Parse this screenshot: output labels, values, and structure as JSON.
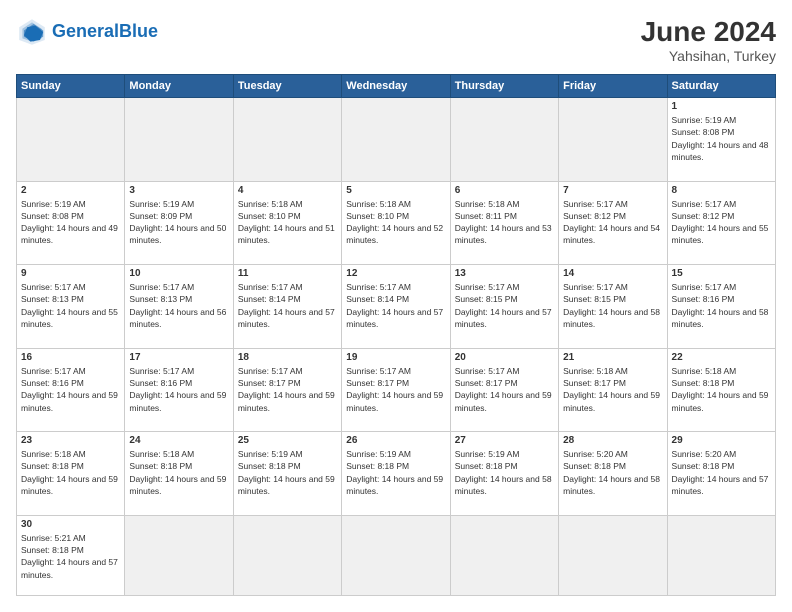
{
  "header": {
    "logo_general": "General",
    "logo_blue": "Blue",
    "month": "June 2024",
    "location": "Yahsihan, Turkey"
  },
  "weekdays": [
    "Sunday",
    "Monday",
    "Tuesday",
    "Wednesday",
    "Thursday",
    "Friday",
    "Saturday"
  ],
  "days": [
    {
      "num": "",
      "empty": true
    },
    {
      "num": "",
      "empty": true
    },
    {
      "num": "",
      "empty": true
    },
    {
      "num": "",
      "empty": true
    },
    {
      "num": "",
      "empty": true
    },
    {
      "num": "",
      "empty": true
    },
    {
      "num": "1",
      "sunrise": "5:19 AM",
      "sunset": "8:08 PM",
      "daylight": "14 hours and 48 minutes."
    },
    {
      "num": "2",
      "sunrise": "5:19 AM",
      "sunset": "8:08 PM",
      "daylight": "14 hours and 49 minutes."
    },
    {
      "num": "3",
      "sunrise": "5:19 AM",
      "sunset": "8:09 PM",
      "daylight": "14 hours and 50 minutes."
    },
    {
      "num": "4",
      "sunrise": "5:18 AM",
      "sunset": "8:10 PM",
      "daylight": "14 hours and 51 minutes."
    },
    {
      "num": "5",
      "sunrise": "5:18 AM",
      "sunset": "8:10 PM",
      "daylight": "14 hours and 52 minutes."
    },
    {
      "num": "6",
      "sunrise": "5:18 AM",
      "sunset": "8:11 PM",
      "daylight": "14 hours and 53 minutes."
    },
    {
      "num": "7",
      "sunrise": "5:17 AM",
      "sunset": "8:12 PM",
      "daylight": "14 hours and 54 minutes."
    },
    {
      "num": "8",
      "sunrise": "5:17 AM",
      "sunset": "8:12 PM",
      "daylight": "14 hours and 55 minutes."
    },
    {
      "num": "9",
      "sunrise": "5:17 AM",
      "sunset": "8:13 PM",
      "daylight": "14 hours and 55 minutes."
    },
    {
      "num": "10",
      "sunrise": "5:17 AM",
      "sunset": "8:13 PM",
      "daylight": "14 hours and 56 minutes."
    },
    {
      "num": "11",
      "sunrise": "5:17 AM",
      "sunset": "8:14 PM",
      "daylight": "14 hours and 57 minutes."
    },
    {
      "num": "12",
      "sunrise": "5:17 AM",
      "sunset": "8:14 PM",
      "daylight": "14 hours and 57 minutes."
    },
    {
      "num": "13",
      "sunrise": "5:17 AM",
      "sunset": "8:15 PM",
      "daylight": "14 hours and 57 minutes."
    },
    {
      "num": "14",
      "sunrise": "5:17 AM",
      "sunset": "8:15 PM",
      "daylight": "14 hours and 58 minutes."
    },
    {
      "num": "15",
      "sunrise": "5:17 AM",
      "sunset": "8:16 PM",
      "daylight": "14 hours and 58 minutes."
    },
    {
      "num": "16",
      "sunrise": "5:17 AM",
      "sunset": "8:16 PM",
      "daylight": "14 hours and 59 minutes."
    },
    {
      "num": "17",
      "sunrise": "5:17 AM",
      "sunset": "8:16 PM",
      "daylight": "14 hours and 59 minutes."
    },
    {
      "num": "18",
      "sunrise": "5:17 AM",
      "sunset": "8:17 PM",
      "daylight": "14 hours and 59 minutes."
    },
    {
      "num": "19",
      "sunrise": "5:17 AM",
      "sunset": "8:17 PM",
      "daylight": "14 hours and 59 minutes."
    },
    {
      "num": "20",
      "sunrise": "5:17 AM",
      "sunset": "8:17 PM",
      "daylight": "14 hours and 59 minutes."
    },
    {
      "num": "21",
      "sunrise": "5:18 AM",
      "sunset": "8:17 PM",
      "daylight": "14 hours and 59 minutes."
    },
    {
      "num": "22",
      "sunrise": "5:18 AM",
      "sunset": "8:18 PM",
      "daylight": "14 hours and 59 minutes."
    },
    {
      "num": "23",
      "sunrise": "5:18 AM",
      "sunset": "8:18 PM",
      "daylight": "14 hours and 59 minutes."
    },
    {
      "num": "24",
      "sunrise": "5:18 AM",
      "sunset": "8:18 PM",
      "daylight": "14 hours and 59 minutes."
    },
    {
      "num": "25",
      "sunrise": "5:19 AM",
      "sunset": "8:18 PM",
      "daylight": "14 hours and 59 minutes."
    },
    {
      "num": "26",
      "sunrise": "5:19 AM",
      "sunset": "8:18 PM",
      "daylight": "14 hours and 59 minutes."
    },
    {
      "num": "27",
      "sunrise": "5:19 AM",
      "sunset": "8:18 PM",
      "daylight": "14 hours and 58 minutes."
    },
    {
      "num": "28",
      "sunrise": "5:20 AM",
      "sunset": "8:18 PM",
      "daylight": "14 hours and 58 minutes."
    },
    {
      "num": "29",
      "sunrise": "5:20 AM",
      "sunset": "8:18 PM",
      "daylight": "14 hours and 57 minutes."
    },
    {
      "num": "30",
      "sunrise": "5:21 AM",
      "sunset": "8:18 PM",
      "daylight": "14 hours and 57 minutes."
    }
  ]
}
